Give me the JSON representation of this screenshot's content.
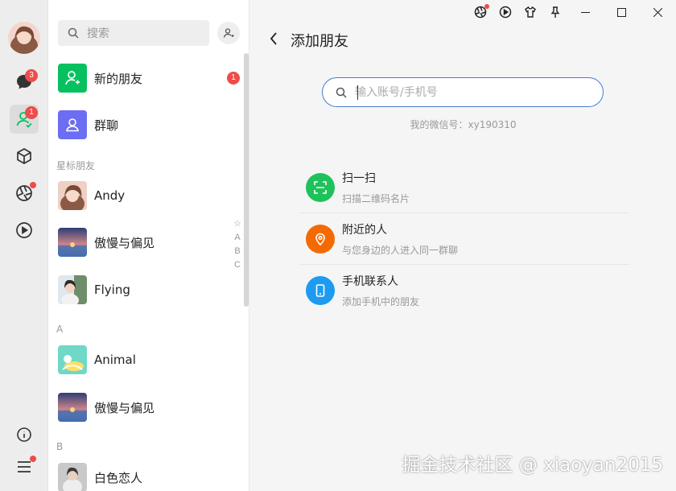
{
  "sidebar": {
    "chat_badge": "3",
    "contacts_badge": "1"
  },
  "contacts": {
    "search_placeholder": "搜索",
    "new_friends_label": "新的朋友",
    "new_friends_badge": "1",
    "group_chat_label": "群聊",
    "starred_section": "星标朋友",
    "section_a": "A",
    "section_b": "B",
    "starred": [
      "Andy",
      "傲慢与偏见",
      "Flying"
    ],
    "a_items": [
      "Animal",
      "傲慢与偏见"
    ],
    "b_items": [
      "白色恋人"
    ],
    "index_letters": [
      "☆",
      "A",
      "B",
      "C"
    ]
  },
  "main": {
    "title": "添加朋友",
    "search_placeholder": "输入账号/手机号",
    "my_wechat_id": "我的微信号：xy190310",
    "options": [
      {
        "title": "扫一扫",
        "subtitle": "扫描二维码名片",
        "color": "#1fc25a",
        "icon": "scan-icon"
      },
      {
        "title": "附近的人",
        "subtitle": "与您身边的人进入同一群聊",
        "color": "#f56a00",
        "icon": "location-icon"
      },
      {
        "title": "手机联系人",
        "subtitle": "添加手机中的朋友",
        "color": "#1d9bf0",
        "icon": "phone-icon"
      }
    ]
  },
  "watermark": "掘金技术社区 @ xiaoyan2015",
  "colors": {
    "accent": "#07c160",
    "badge": "#f04b4b",
    "search_border": "#4a7bd0"
  }
}
